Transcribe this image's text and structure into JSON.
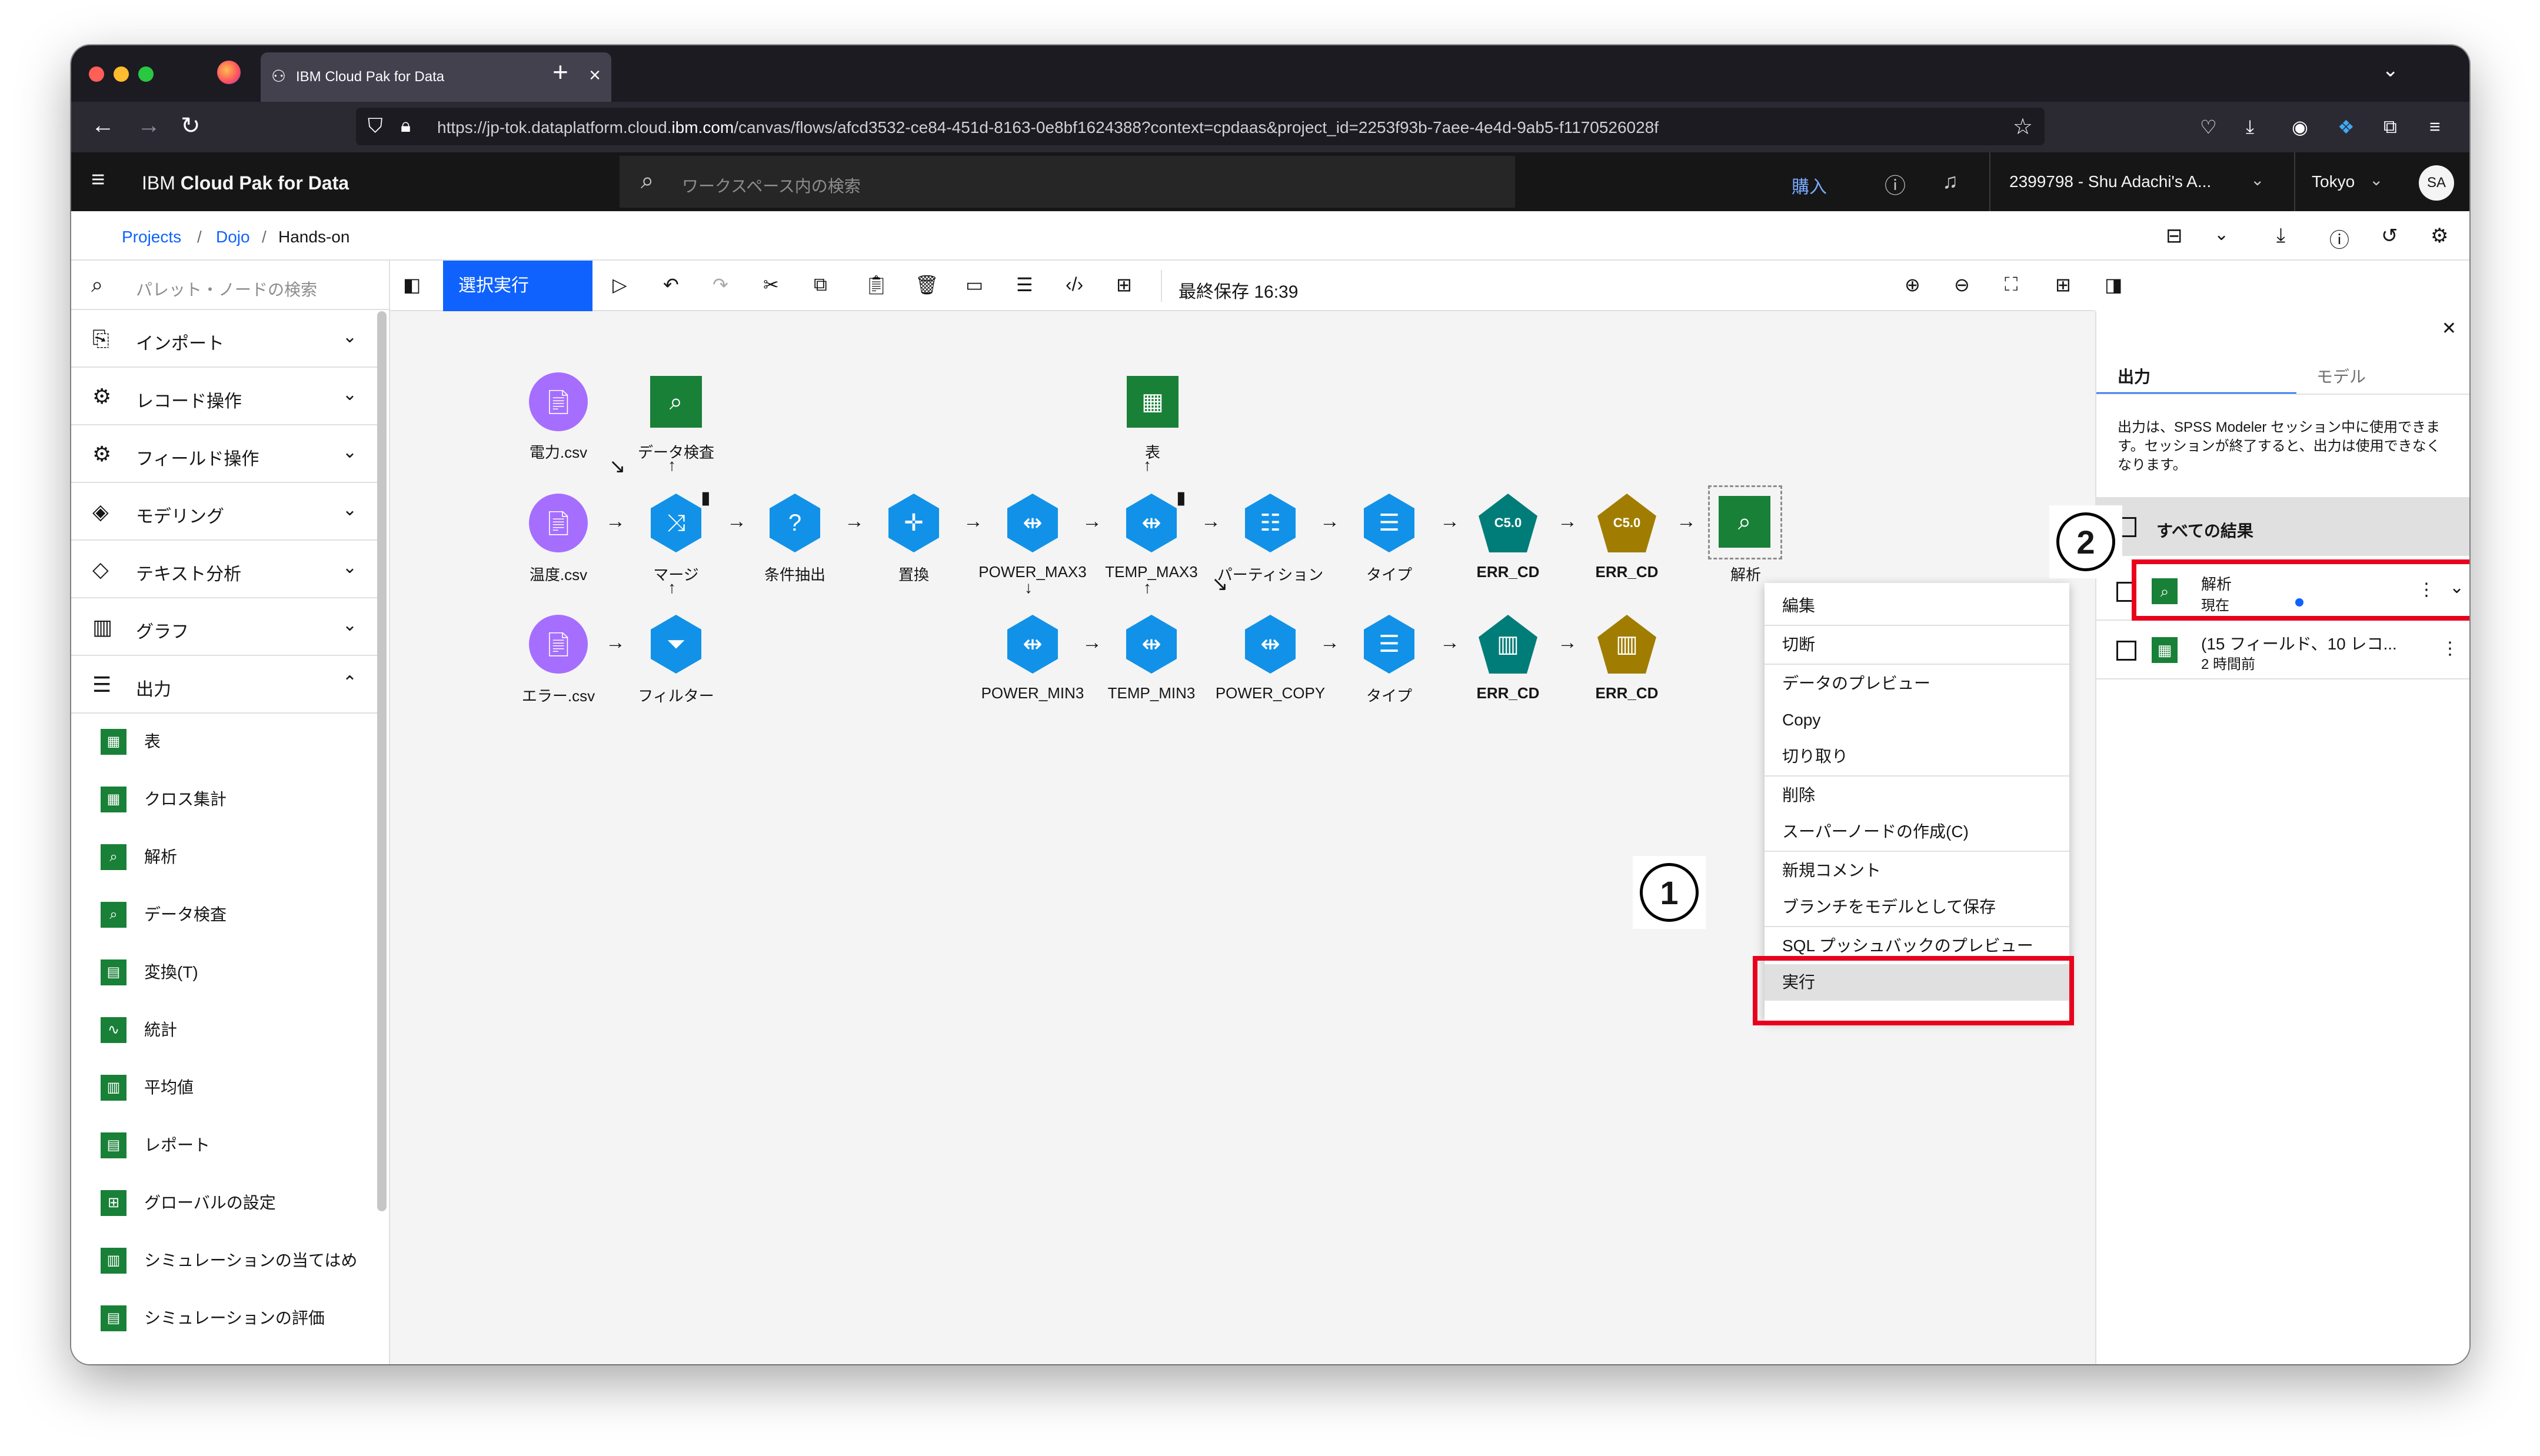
{
  "browser": {
    "tab_title": "IBM Cloud Pak for Data",
    "tab_close": "×",
    "new_tab": "+",
    "url_prefix": "https://jp-tok.dataplatform.cloud.",
    "url_domain": "ibm.com",
    "url_rest": "/canvas/flows/afcd3532-ce84-451d-8163-0e8bf1624388?context=cpdaas&project_id=2253f93b-7aee-4e4d-9ab5-f1170526028f",
    "dot_colors": [
      "#ff5f57",
      "#febc2e",
      "#28c840"
    ]
  },
  "app": {
    "brand_prefix": "IBM ",
    "brand_name": "Cloud Pak for Data",
    "search_placeholder": "ワークスペース内の検索",
    "buy": "購入",
    "account": "2399798 - Shu Adachi's A...",
    "region": "Tokyo",
    "avatar": "SA"
  },
  "breadcrumb": {
    "projects": "Projects",
    "sep": "/",
    "dojo": "Dojo",
    "current": "Hands-on"
  },
  "palette": {
    "search_placeholder": "パレット・ノードの検索",
    "categories": [
      {
        "label": "インポート",
        "icon": "import-icon"
      },
      {
        "label": "レコード操作",
        "icon": "record-ops-icon"
      },
      {
        "label": "フィールド操作",
        "icon": "field-ops-icon"
      },
      {
        "label": "モデリング",
        "icon": "modeling-icon"
      },
      {
        "label": "テキスト分析",
        "icon": "text-analysis-icon"
      },
      {
        "label": "グラフ",
        "icon": "graph-icon"
      },
      {
        "label": "出力",
        "icon": "output-icon"
      }
    ],
    "output_items": [
      "表",
      "クロス集計",
      "解析",
      "データ検査",
      "変換(T)",
      "統計",
      "平均値",
      "レポート",
      "グローバルの設定",
      "シミュレーションの当てはめ",
      "シミュレーションの評価"
    ]
  },
  "toolbar": {
    "run_selection": "選択実行",
    "last_saved": "最終保存 16:39"
  },
  "canvas": {
    "nodes": [
      {
        "id": "n1",
        "label": "電力.csv"
      },
      {
        "id": "n2",
        "label": "データ検査"
      },
      {
        "id": "n3",
        "label": "表"
      },
      {
        "id": "n4",
        "label": "温度.csv"
      },
      {
        "id": "n5",
        "label": "マージ"
      },
      {
        "id": "n6",
        "label": "条件抽出"
      },
      {
        "id": "n7",
        "label": "置換"
      },
      {
        "id": "n8",
        "label": "POWER_MAX3"
      },
      {
        "id": "n9",
        "label": "TEMP_MAX3"
      },
      {
        "id": "n10",
        "label": "パーティション"
      },
      {
        "id": "n11",
        "label": "タイプ"
      },
      {
        "id": "n12",
        "label": "ERR_CD"
      },
      {
        "id": "n13",
        "label": "ERR_CD"
      },
      {
        "id": "n14",
        "label": "解析"
      },
      {
        "id": "n15",
        "label": "エラー.csv"
      },
      {
        "id": "n16",
        "label": "フィルター"
      },
      {
        "id": "n17",
        "label": "POWER_MIN3"
      },
      {
        "id": "n18",
        "label": "TEMP_MIN3"
      },
      {
        "id": "n19",
        "label": "POWER_COPY"
      },
      {
        "id": "n20",
        "label": "タイプ"
      },
      {
        "id": "n21",
        "label": "ERR_CD"
      },
      {
        "id": "n22",
        "label": "ERR_CD"
      }
    ],
    "c50_text": "C5.0"
  },
  "context_menu": [
    "編集",
    "切断",
    "データのプレビュー",
    "Copy",
    "切り取り",
    "削除",
    "スーパーノードの作成(C)",
    "新規コメント",
    "ブランチをモデルとして保存",
    "SQL プッシュバックのプレビュー",
    "実行"
  ],
  "annotations": {
    "badge1": "1",
    "badge2": "2"
  },
  "right_panel": {
    "tabs": [
      "出力",
      "モデル"
    ],
    "description": "出力は、SPSS Modeler セッション中に使用できます。セッションが終了すると、出力は使用できなくなります。",
    "all_results": "すべての結果",
    "results": [
      {
        "title": "解析",
        "subtitle": "現在"
      },
      {
        "title": "(15 フィールド、10 レコ...",
        "subtitle": "2 時間前"
      }
    ]
  },
  "colors": {
    "primary": "#0f62fe",
    "highlight": "#e8001c",
    "source_node": "#a56eff",
    "process_node": "#1192e8",
    "output_node": "#198038",
    "model_teal": "#007d79",
    "model_gold": "#a07d00"
  }
}
